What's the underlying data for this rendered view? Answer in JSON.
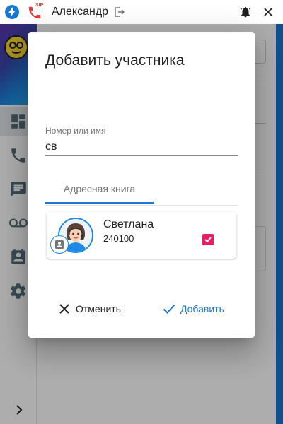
{
  "titlebar": {
    "sip_label": "SIP",
    "user_name": "Александр",
    "icons": [
      "app-logo-icon",
      "sip-phone-icon",
      "logout-icon",
      "bell-icon",
      "close-icon"
    ]
  },
  "sidebar": {
    "items": [
      {
        "name": "dashboard",
        "icon": "dashboard-icon",
        "active": true
      },
      {
        "name": "calls",
        "icon": "phone-icon",
        "active": false
      },
      {
        "name": "chat",
        "icon": "chat-icon",
        "active": false
      },
      {
        "name": "voicemail",
        "icon": "voicemail-icon",
        "active": false
      },
      {
        "name": "contacts",
        "icon": "contacts-icon",
        "active": false
      },
      {
        "name": "settings",
        "icon": "settings-icon",
        "active": false
      }
    ],
    "expand_icon": "chevron-right-icon"
  },
  "dialog": {
    "title": "Добавить участника",
    "search": {
      "label": "Номер или имя",
      "value": "св"
    },
    "tabs": [
      {
        "label": "Адресная книга",
        "active": true
      }
    ],
    "results": [
      {
        "name": "Светлана",
        "number": "240100",
        "checked": true
      }
    ],
    "cancel_label": "Отменить",
    "add_label": "Добавить"
  },
  "colors": {
    "accent": "#1976d2",
    "checkbox": "#e91e63",
    "sip_red": "#e53935",
    "overlay": "rgba(0,0,0,0.32)"
  }
}
